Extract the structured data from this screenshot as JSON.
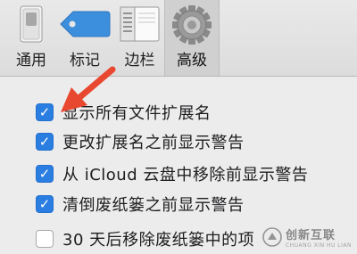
{
  "toolbar": {
    "tabs": [
      {
        "label": "通用",
        "icon": "switch-icon"
      },
      {
        "label": "标记",
        "icon": "tag-icon"
      },
      {
        "label": "边栏",
        "icon": "sidebar-icon"
      },
      {
        "label": "高级",
        "icon": "gear-icon"
      }
    ],
    "selected_tab": "高级"
  },
  "options": [
    {
      "label": "显示所有文件扩展名",
      "checked": true
    },
    {
      "label": "更改扩展名之前显示警告",
      "checked": true
    },
    {
      "label": "从 iCloud 云盘中移除前显示警告",
      "checked": true
    },
    {
      "label": "清倒废纸篓之前显示警告",
      "checked": true
    },
    {
      "label": "30 天后移除废纸篓中的项",
      "checked": false
    }
  ],
  "watermark": {
    "cn": "创新互联",
    "en": "CHUANG XIN HU LIAN"
  },
  "colors": {
    "accent": "#2a7de1",
    "arrow": "#e8482f",
    "tag_blue": "#3b8fdc"
  }
}
